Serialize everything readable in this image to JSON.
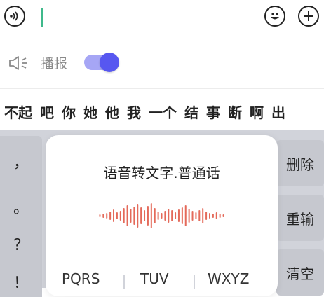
{
  "top_bar": {
    "voice_icon": "voice-waves-icon",
    "emoji_icon": "smiley-icon",
    "add_icon": "plus-icon"
  },
  "broadcast": {
    "icon": "speaker-icon",
    "label": "播报",
    "enabled": true
  },
  "candidates": [
    "不起",
    "吧",
    "你",
    "她",
    "他",
    "我",
    "一个",
    "结",
    "事",
    "断",
    "啊",
    "出"
  ],
  "punctuation": [
    "，",
    "。",
    "？",
    "！"
  ],
  "right_keys": {
    "delete": "删除",
    "reenter": "重输",
    "clear": "清空"
  },
  "voice_panel": {
    "title": "语音转文字.普通话",
    "wave_color": "#e46a5a"
  },
  "bottom_keys": [
    "PQRS",
    "TUV",
    "WXYZ"
  ],
  "colors": {
    "toggle_track": "#a6a6f5",
    "toggle_knob": "#5757f0",
    "cursor": "#3fb98b",
    "keyboard_bg": "#d1d3da"
  }
}
